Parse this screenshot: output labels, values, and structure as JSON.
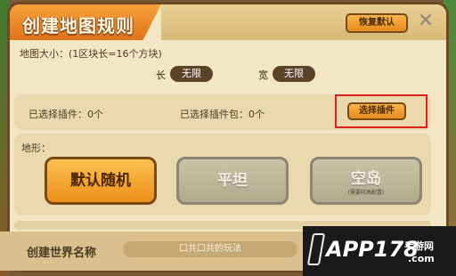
{
  "dialog": {
    "title": "创建地图规则",
    "restore_default_label": "恢复默认",
    "close_glyph": "✕"
  },
  "map_size": {
    "description": "地图大小：(1区块长=16个方块)",
    "length_label": "长",
    "length_value": "无限",
    "width_label": "宽",
    "width_value": "无限"
  },
  "plugins": {
    "selected_plugins": "已选择插件：0个",
    "selected_packs": "已选择插件包：0个",
    "select_button_label": "选择插件"
  },
  "terrain": {
    "title": "地形：",
    "options": [
      {
        "label": "默认随机",
        "note": "",
        "selected": true
      },
      {
        "label": "平坦",
        "note": "",
        "selected": false
      },
      {
        "label": "空岛",
        "note": "(需要较高配置)",
        "selected": false
      }
    ]
  },
  "world_name": {
    "label": "创建世界名称",
    "value": "口共口共的玩法"
  },
  "watermark": {
    "main": "APP178",
    "sub": "手游网",
    "domain": ".com"
  },
  "colors": {
    "accent_orange": "#f7a23a",
    "highlight_red": "#e0201c",
    "panel_bg": "#f3e6c4"
  }
}
